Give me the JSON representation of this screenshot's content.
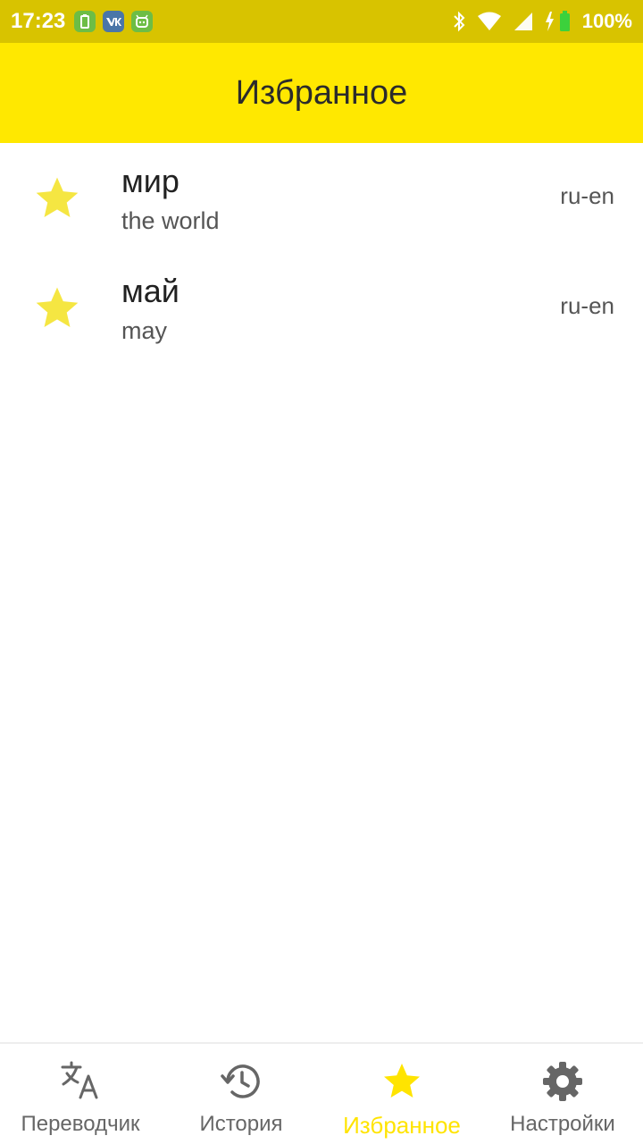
{
  "status_bar": {
    "time": "17:23",
    "battery": "100%",
    "app_icons": [
      "battery-app-icon",
      "vk-icon",
      "android-app-icon"
    ]
  },
  "app_bar": {
    "title": "Избранное"
  },
  "favorites": [
    {
      "word": "мир",
      "translation": "the world",
      "lang": "ru-en"
    },
    {
      "word": "май",
      "translation": "may",
      "lang": "ru-en"
    }
  ],
  "bottom_nav": {
    "items": [
      {
        "label": "Переводчик",
        "icon": "translate-icon",
        "active": false
      },
      {
        "label": "История",
        "icon": "history-icon",
        "active": false
      },
      {
        "label": "Избранное",
        "icon": "star-icon",
        "active": true
      },
      {
        "label": "Настройки",
        "icon": "gear-icon",
        "active": false
      }
    ]
  },
  "colors": {
    "status_bar": "#d8c300",
    "app_bar": "#ffe800",
    "star": "#f5e642",
    "active_nav": "#ffe400",
    "inactive_nav": "#666666"
  }
}
